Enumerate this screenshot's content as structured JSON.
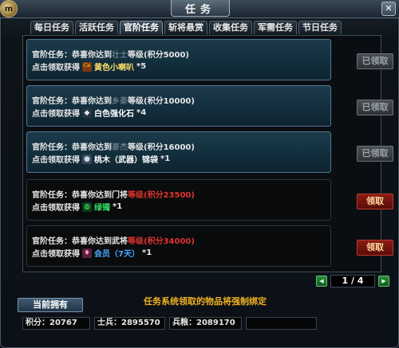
{
  "window": {
    "title": "任务",
    "logo_text": "m",
    "close_icon": "close-icon"
  },
  "tabs": [
    {
      "label": "每日任务",
      "active": false
    },
    {
      "label": "活跃任务",
      "active": false
    },
    {
      "label": "官阶任务",
      "active": true
    },
    {
      "label": "斩将悬赏",
      "active": false
    },
    {
      "label": "收集任务",
      "active": false
    },
    {
      "label": "军需任务",
      "active": false
    },
    {
      "label": "节日任务",
      "active": false
    }
  ],
  "tasks": [
    {
      "prefix": "官阶任务：恭喜你达到",
      "rank": "壮士",
      "suffix": "等级(积分5000)",
      "reward_prefix": "点击领取获得",
      "reward_icon": "horn-icon",
      "reward_name": "黄色小喇叭",
      "reward_qty": "*5",
      "button": "已领取",
      "state": "claimed"
    },
    {
      "prefix": "官阶任务：恭喜你达到",
      "rank": "乡豪",
      "suffix": "等级(积分10000)",
      "reward_prefix": "点击领取获得",
      "reward_icon": "stone-icon",
      "reward_name": "白色强化石",
      "reward_qty": "*4",
      "button": "已领取",
      "state": "claimed"
    },
    {
      "prefix": "官阶任务：恭喜你达到",
      "rank": "豪杰",
      "suffix": "等级(积分16000)",
      "reward_prefix": "点击领取获得",
      "reward_icon": "bag-icon",
      "reward_name": "桃木（武器）锦袋",
      "reward_qty": "*1",
      "button": "已领取",
      "state": "claimed"
    },
    {
      "prefix": "官阶任务：恭喜你达到门将",
      "rank": "等级(积分23500)",
      "suffix": "",
      "reward_prefix": "点击领取获得",
      "reward_icon": "jade-icon",
      "reward_name": "绿镯",
      "reward_qty": "*1",
      "button": "领取",
      "state": "available"
    },
    {
      "prefix": "官阶任务：恭喜你达到武将",
      "rank": "等级(积分34000)",
      "suffix": "",
      "reward_prefix": "点击领取获得",
      "reward_icon": "vip-icon",
      "reward_name": "会员（7天）",
      "reward_qty": "*1",
      "button": "领取",
      "state": "available"
    }
  ],
  "pager": {
    "text": "1 / 4",
    "prev_icon": "arrow-left-icon",
    "next_icon": "arrow-right-icon"
  },
  "footer": {
    "owned_label": "当前拥有",
    "notice": "任务系统领取的物品将强制绑定",
    "score": "积分：20767",
    "soldiers": "士兵：2895570",
    "grain": "兵粮：2089170",
    "extra": ""
  },
  "colors": {
    "claimed_bg": "#13303f",
    "available_bg": "#090b0d",
    "accent_red": "#e0342a",
    "notice": "#f0b020"
  }
}
